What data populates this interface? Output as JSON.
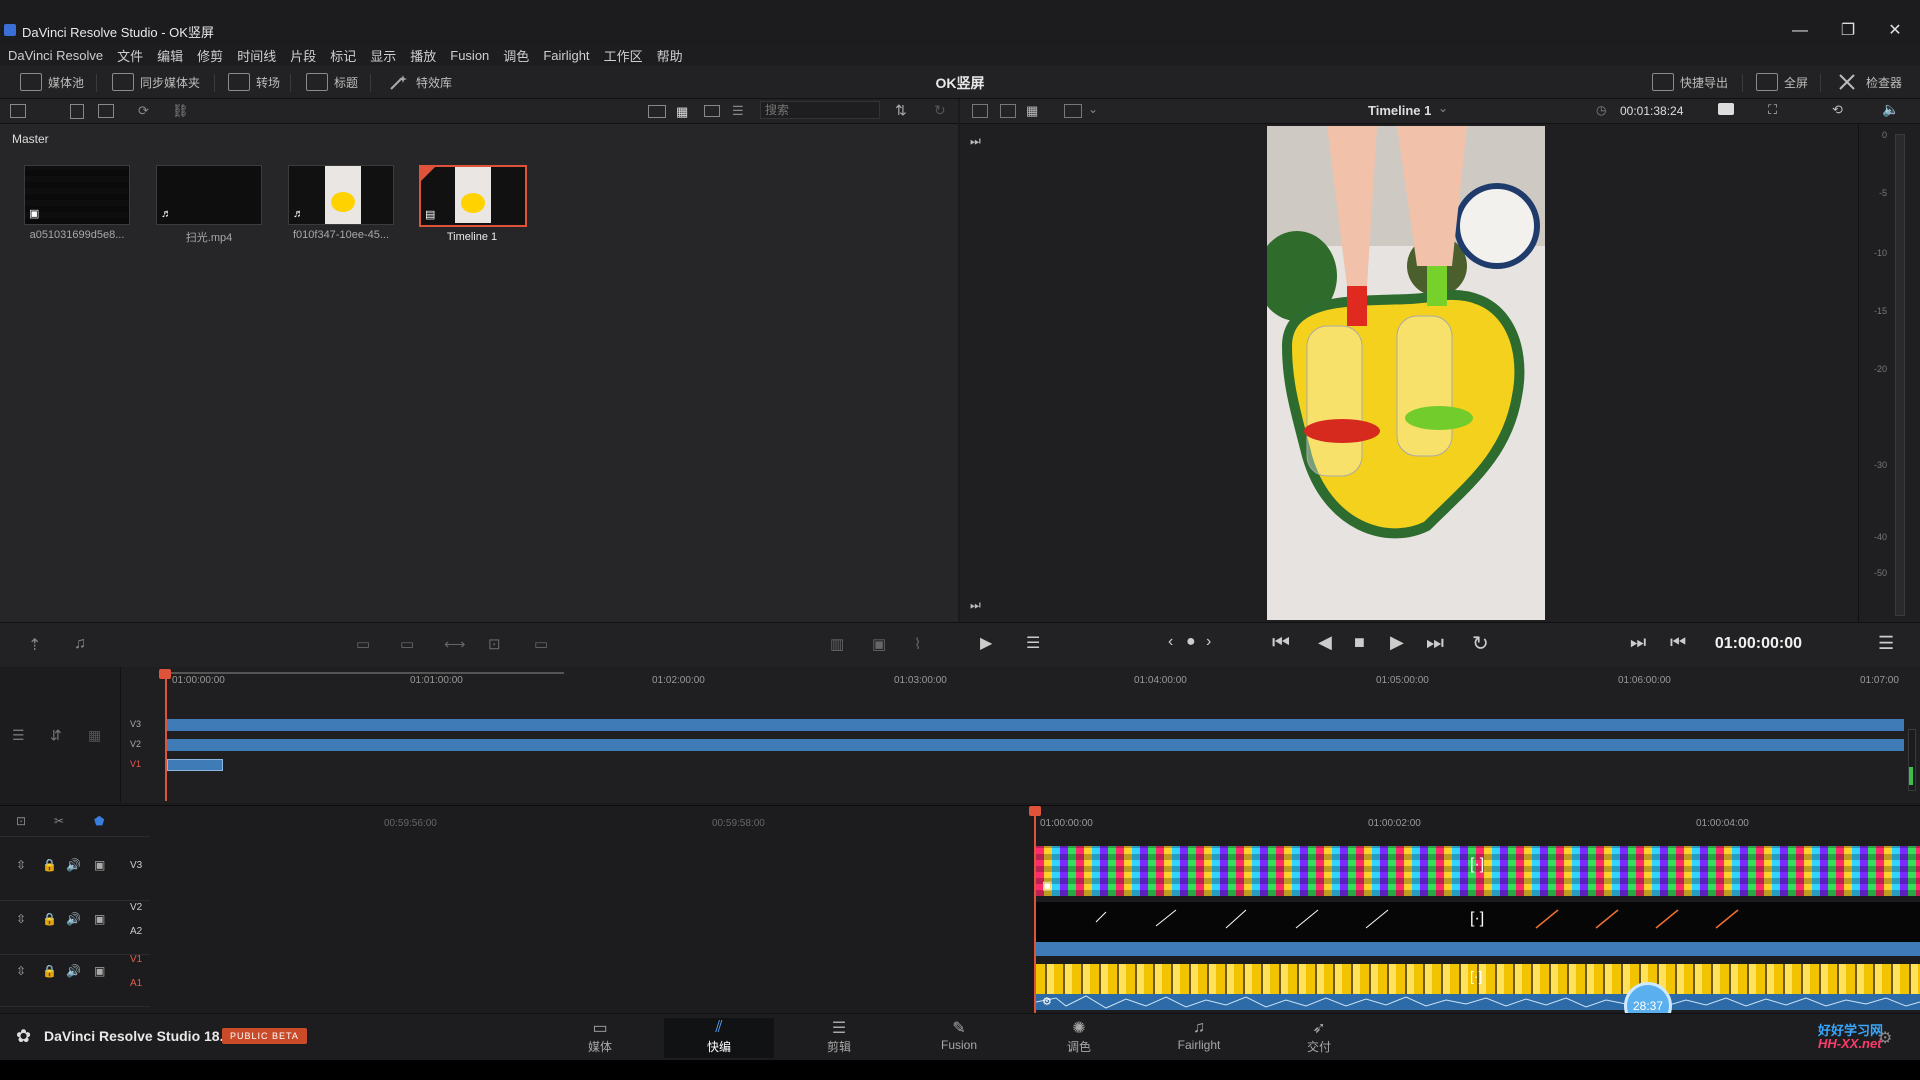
{
  "window": {
    "title": "DaVinci Resolve Studio - OK竖屏",
    "controls": [
      "—",
      "❐",
      "✕"
    ]
  },
  "menu": [
    "DaVinci Resolve",
    "文件",
    "编辑",
    "修剪",
    "时间线",
    "片段",
    "标记",
    "显示",
    "播放",
    "Fusion",
    "调色",
    "Fairlight",
    "工作区",
    "帮助"
  ],
  "toolbar": {
    "project_title": "OK竖屏",
    "left": [
      {
        "label": "媒体池",
        "icon": "media-pool-icon"
      },
      {
        "label": "同步媒体夹",
        "icon": "sync-bin-icon"
      },
      {
        "label": "转场",
        "icon": "transitions-icon"
      },
      {
        "label": "标题",
        "icon": "titles-icon"
      },
      {
        "label": "特效库",
        "icon": "effects-icon"
      }
    ],
    "right": [
      {
        "label": "快捷导出",
        "icon": "quick-export-icon"
      },
      {
        "label": "全屏",
        "icon": "fullscreen-icon"
      },
      {
        "label": "检查器",
        "icon": "inspector-icon"
      }
    ]
  },
  "media_pool": {
    "search_placeholder": "搜索",
    "breadcrumb": "Master",
    "clips": [
      {
        "name": "a051031699d5e8...",
        "type": "image",
        "selected": false
      },
      {
        "name": "扫光.mp4",
        "type": "audio",
        "selected": false
      },
      {
        "name": "f010f347-10ee-45...",
        "type": "audio-video",
        "selected": false
      },
      {
        "name": "Timeline 1",
        "type": "timeline",
        "selected": true
      }
    ]
  },
  "viewer": {
    "timeline_name": "Timeline 1",
    "duration": "00:01:38:24",
    "current_timecode": "01:00:00:00"
  },
  "meter_ticks": [
    "0",
    "-5",
    "-10",
    "-15",
    "-20",
    "-30",
    "-40",
    "-50"
  ],
  "upper_timeline": {
    "ruler": [
      "01:00:00:00",
      "01:01:00:00",
      "01:02:00:00",
      "01:03:00:00",
      "01:04:00:00",
      "01:05:00:00",
      "01:06:00:00",
      "01:07:00"
    ],
    "tracks": [
      "V3",
      "V2",
      "V1"
    ]
  },
  "lower_timeline": {
    "ruler": [
      "00:59:56:00",
      "00:59:58:00",
      "01:00:00:00",
      "01:00:02:00",
      "01:00:04:00"
    ],
    "tracks": [
      {
        "video": "V3",
        "audio": ""
      },
      {
        "video": "V2",
        "audio": "A2"
      },
      {
        "video": "V1",
        "audio": "A1"
      }
    ],
    "overlay_timer": "28:37"
  },
  "pages": [
    {
      "label": "媒体",
      "icon": "media-page-icon"
    },
    {
      "label": "快编",
      "icon": "cut-page-icon",
      "active": true
    },
    {
      "label": "剪辑",
      "icon": "edit-page-icon"
    },
    {
      "label": "Fusion",
      "icon": "fusion-page-icon"
    },
    {
      "label": "调色",
      "icon": "color-page-icon"
    },
    {
      "label": "Fairlight",
      "icon": "fairlight-page-icon"
    },
    {
      "label": "交付",
      "icon": "deliver-page-icon"
    }
  ],
  "brand": {
    "name": "DaVinci Resolve Studio 18.5",
    "badge": "PUBLIC BETA"
  },
  "watermark": {
    "line1": "好好学习网",
    "line2": "HH-XX.net"
  },
  "colors": {
    "accent_red": "#e0533b",
    "track_blue": "#3f7bb6",
    "beta_badge": "#c94b2a"
  }
}
